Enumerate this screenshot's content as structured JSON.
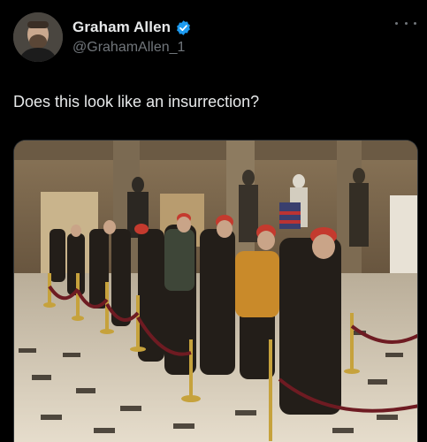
{
  "author": {
    "display_name": "Graham Allen",
    "handle": "@GrahamAllen_1",
    "verified": true,
    "avatar_icon": "person-avatar"
  },
  "tweet": {
    "text": "Does this look like an insurrection?"
  },
  "media": {
    "type": "photo"
  },
  "colors": {
    "background": "#000000",
    "primary_text": "#e7e9ea",
    "secondary_text": "#71767b",
    "verified_badge": "#1d9bf0"
  }
}
